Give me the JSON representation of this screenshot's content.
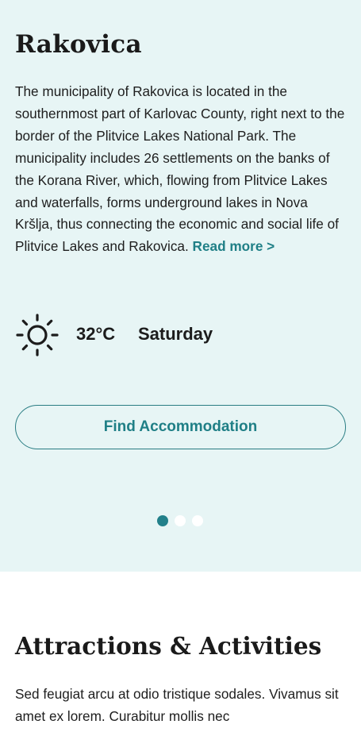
{
  "hero": {
    "title": "Rakovica",
    "description": "The municipality of Rakovica is located in the southernmost part of Karlovac County, right next to the border of the Plitvice Lakes National Park. The municipality includes 26 settlements on the banks of the Korana River, which, flowing from Plitvice Lakes and waterfalls, forms underground lakes in Nova Kršlja, thus connecting the economic and social life of Plitvice Lakes and Rakovica. ",
    "read_more": "Read more >"
  },
  "weather": {
    "icon": "sun-icon",
    "temperature": "32°C",
    "day": "Saturday"
  },
  "cta": {
    "label": "Find Accommodation"
  },
  "carousel": {
    "slides": 3,
    "active": 0
  },
  "attractions": {
    "title": "Attractions & Activities",
    "text": "Sed feugiat arcu at odio tristique sodales. Vivamus sit amet ex lorem. Curabitur mollis nec"
  },
  "colors": {
    "hero_background": "#e7f5f5",
    "accent": "#1f7f86",
    "dot_active": "#22808a",
    "dot_inactive": "#ffffff"
  }
}
